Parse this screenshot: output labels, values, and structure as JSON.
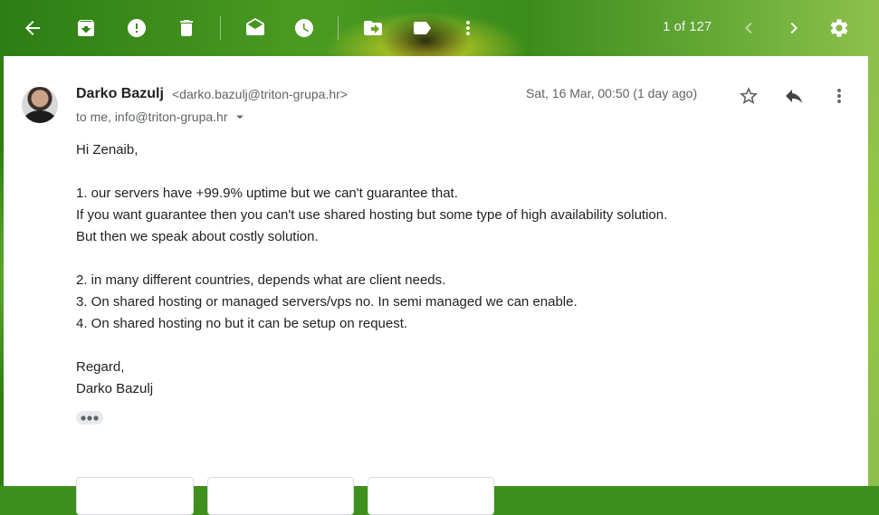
{
  "toolbar": {
    "pager_text": "1 of 127",
    "buttons": [
      "back-icon",
      "archive-icon",
      "report-spam-icon",
      "delete-icon",
      "mark-unread-icon",
      "snooze-icon",
      "move-to-icon",
      "labels-icon",
      "more-vert-icon",
      "chevron-left-icon",
      "chevron-right-icon",
      "settings-gear-icon"
    ]
  },
  "message": {
    "sender_name": "Darko Bazulj",
    "sender_email": "<darko.bazulj@triton-grupa.hr>",
    "to_line": "to me, info@triton-grupa.hr",
    "date": "Sat, 16 Mar, 00:50 (1 day ago)",
    "body_lines": [
      "Hi Zenaib,",
      "",
      "1. our servers have +99.9% uptime but we can't guarantee that.",
      "If you want guarantee then you can't use shared hosting but some type of high availability solution.",
      "But then we speak about costly solution.",
      "",
      "2. in many different countries, depends what are client needs.",
      "3. On shared hosting or managed servers/vps no. In semi managed we can enable.",
      "4. On shared hosting no but it can be setup on request.",
      "",
      "Regard,",
      "Darko Bazulj"
    ]
  },
  "colors": {
    "pane_bg": "#ffffff",
    "text_primary": "#202124",
    "text_secondary": "#5f6368"
  }
}
